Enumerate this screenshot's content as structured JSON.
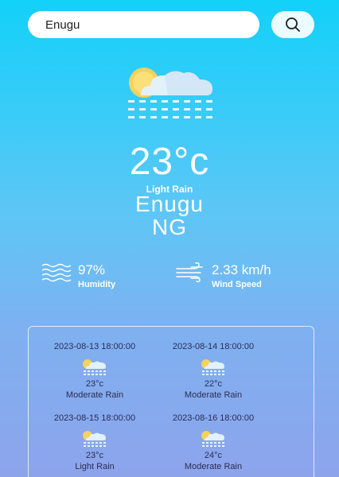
{
  "search": {
    "value": "Enugu",
    "placeholder": "",
    "button_icon": "search-icon"
  },
  "current": {
    "icon": "cloud-sun-rain-icon",
    "temperature": "23°c",
    "condition": "Light Rain",
    "city": "Enugu",
    "country": "NG"
  },
  "stats": {
    "humidity": {
      "value": "97%",
      "label": "Humidity",
      "icon": "humidity-waves-icon"
    },
    "wind": {
      "value": "2.33 km/h",
      "label": "Wind Speed",
      "icon": "wind-icon"
    }
  },
  "forecast": [
    {
      "date": "2023-08-13 18:00:00",
      "temp": "23°c",
      "desc": "Moderate Rain",
      "icon": "cloud-sun-rain-icon"
    },
    {
      "date": "2023-08-14 18:00:00",
      "temp": "22°c",
      "desc": "Moderate Rain",
      "icon": "cloud-sun-rain-icon"
    },
    {
      "date": "2023-08-15 18:00:00",
      "temp": "23°c",
      "desc": "Light Rain",
      "icon": "cloud-sun-rain-icon"
    },
    {
      "date": "2023-08-16 18:00:00",
      "temp": "24°c",
      "desc": "Moderate Rain",
      "icon": "cloud-sun-rain-icon"
    }
  ]
}
